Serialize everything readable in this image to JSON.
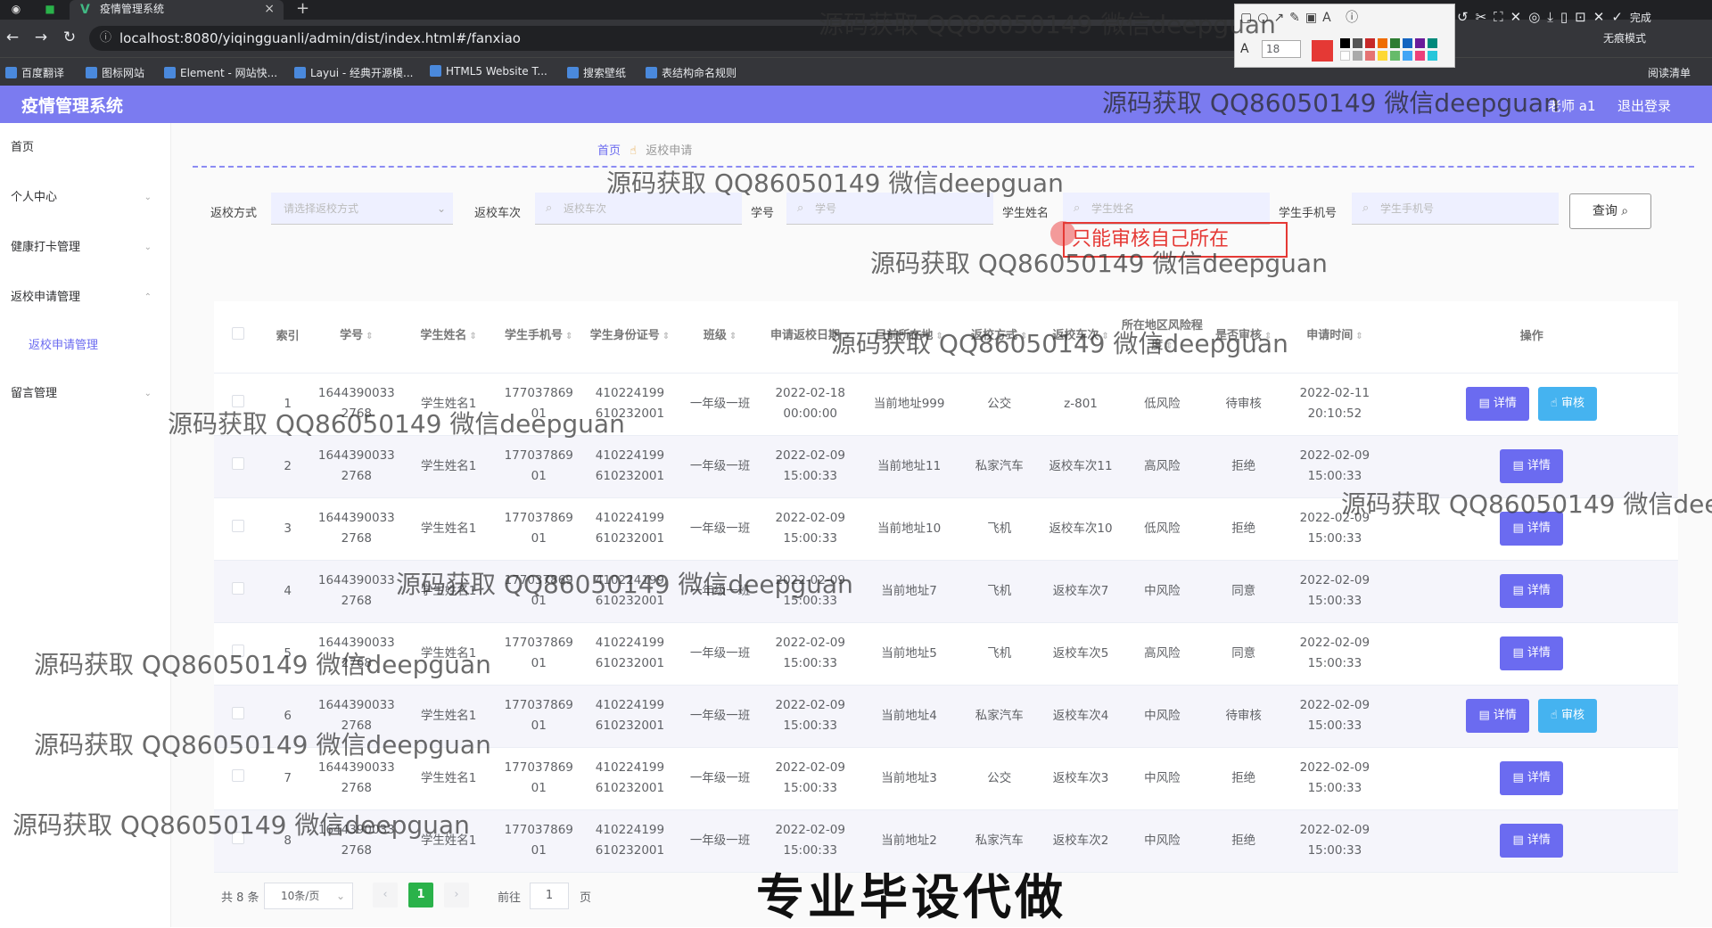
{
  "browser": {
    "tab_title": "疫情管理系统",
    "url": "localhost:8080/yiqingguanli/admin/dist/index.html#/fanxiao",
    "incognito": "无痕模式",
    "reading_list": "阅读清单",
    "bookmarks": [
      {
        "label": "百度翻译"
      },
      {
        "label": "图标网站"
      },
      {
        "label": "Element - 网站快..."
      },
      {
        "label": "Layui - 经典开源模..."
      },
      {
        "label": "HTML5 Website T..."
      },
      {
        "label": "搜索壁纸"
      },
      {
        "label": "表结构命名规则"
      }
    ]
  },
  "annotation_toolbar": {
    "font_size": "18",
    "done_label": "完成"
  },
  "app": {
    "title": "疫情管理系统",
    "user": "老师 a1",
    "logout": "退出登录"
  },
  "sidebar": {
    "items": [
      {
        "label": "首页"
      },
      {
        "label": "个人中心"
      },
      {
        "label": "健康打卡管理"
      },
      {
        "label": "返校申请管理"
      },
      {
        "label": "返校申请管理"
      },
      {
        "label": "留言管理"
      }
    ]
  },
  "breadcrumb": {
    "home": "首页",
    "current": "返校申请"
  },
  "filters": {
    "return_method": {
      "label": "返校方式",
      "placeholder": "请选择返校方式"
    },
    "train": {
      "label": "返校车次",
      "placeholder": "返校车次"
    },
    "student_no": {
      "label": "学号",
      "placeholder": "学号"
    },
    "student_name": {
      "label": "学生姓名",
      "placeholder": "学生姓名"
    },
    "student_phone": {
      "label": "学生手机号",
      "placeholder": "学生手机号"
    },
    "query_button": "查询"
  },
  "hint": "只能审核自己所在",
  "table": {
    "headers": [
      "索引",
      "学号",
      "学生姓名",
      "学生手机号",
      "学生身份证号",
      "班级",
      "申请返校日期",
      "目前所在地",
      "返校方式",
      "返校车次",
      "所在地区风险程度",
      "是否审核",
      "申请时间",
      "操作"
    ],
    "rows": [
      {
        "idx": "1",
        "no_a": "1644390033",
        "no_b": "2768",
        "name": "学生姓名1",
        "ph_a": "177037869",
        "ph_b": "01",
        "id_a": "410224199",
        "id_b": "610232001",
        "cls": "一年级一班",
        "dt_a": "2022-02-18",
        "dt_b": "00:00:00",
        "loc": "当前地址999",
        "method": "公交",
        "train": "z-801",
        "risk": "低风险",
        "status": "待审核",
        "at_a": "2022-02-11",
        "at_b": "20:10:52",
        "audit": true
      },
      {
        "idx": "2",
        "no_a": "1644390033",
        "no_b": "2768",
        "name": "学生姓名1",
        "ph_a": "177037869",
        "ph_b": "01",
        "id_a": "410224199",
        "id_b": "610232001",
        "cls": "一年级一班",
        "dt_a": "2022-02-09",
        "dt_b": "15:00:33",
        "loc": "当前地址11",
        "method": "私家汽车",
        "train": "返校车次11",
        "risk": "高风险",
        "status": "拒绝",
        "at_a": "2022-02-09",
        "at_b": "15:00:33",
        "audit": false
      },
      {
        "idx": "3",
        "no_a": "1644390033",
        "no_b": "2768",
        "name": "学生姓名1",
        "ph_a": "177037869",
        "ph_b": "01",
        "id_a": "410224199",
        "id_b": "610232001",
        "cls": "一年级一班",
        "dt_a": "2022-02-09",
        "dt_b": "15:00:33",
        "loc": "当前地址10",
        "method": "飞机",
        "train": "返校车次10",
        "risk": "低风险",
        "status": "拒绝",
        "at_a": "2022-02-09",
        "at_b": "15:00:33",
        "audit": false
      },
      {
        "idx": "4",
        "no_a": "1644390033",
        "no_b": "2768",
        "name": "学生姓名1",
        "ph_a": "177037869",
        "ph_b": "01",
        "id_a": "410224199",
        "id_b": "610232001",
        "cls": "一年级一班",
        "dt_a": "2022-02-09",
        "dt_b": "15:00:33",
        "loc": "当前地址7",
        "method": "飞机",
        "train": "返校车次7",
        "risk": "中风险",
        "status": "同意",
        "at_a": "2022-02-09",
        "at_b": "15:00:33",
        "audit": false
      },
      {
        "idx": "5",
        "no_a": "1644390033",
        "no_b": "2768",
        "name": "学生姓名1",
        "ph_a": "177037869",
        "ph_b": "01",
        "id_a": "410224199",
        "id_b": "610232001",
        "cls": "一年级一班",
        "dt_a": "2022-02-09",
        "dt_b": "15:00:33",
        "loc": "当前地址5",
        "method": "飞机",
        "train": "返校车次5",
        "risk": "高风险",
        "status": "同意",
        "at_a": "2022-02-09",
        "at_b": "15:00:33",
        "audit": false
      },
      {
        "idx": "6",
        "no_a": "1644390033",
        "no_b": "2768",
        "name": "学生姓名1",
        "ph_a": "177037869",
        "ph_b": "01",
        "id_a": "410224199",
        "id_b": "610232001",
        "cls": "一年级一班",
        "dt_a": "2022-02-09",
        "dt_b": "15:00:33",
        "loc": "当前地址4",
        "method": "私家汽车",
        "train": "返校车次4",
        "risk": "中风险",
        "status": "待审核",
        "at_a": "2022-02-09",
        "at_b": "15:00:33",
        "audit": true
      },
      {
        "idx": "7",
        "no_a": "1644390033",
        "no_b": "2768",
        "name": "学生姓名1",
        "ph_a": "177037869",
        "ph_b": "01",
        "id_a": "410224199",
        "id_b": "610232001",
        "cls": "一年级一班",
        "dt_a": "2022-02-09",
        "dt_b": "15:00:33",
        "loc": "当前地址3",
        "method": "公交",
        "train": "返校车次3",
        "risk": "中风险",
        "status": "拒绝",
        "at_a": "2022-02-09",
        "at_b": "15:00:33",
        "audit": false
      },
      {
        "idx": "8",
        "no_a": "1644390033",
        "no_b": "2768",
        "name": "学生姓名1",
        "ph_a": "177037869",
        "ph_b": "01",
        "id_a": "410224199",
        "id_b": "610232001",
        "cls": "一年级一班",
        "dt_a": "2022-02-09",
        "dt_b": "15:00:33",
        "loc": "当前地址2",
        "method": "私家汽车",
        "train": "返校车次2",
        "risk": "中风险",
        "status": "拒绝",
        "at_a": "2022-02-09",
        "at_b": "15:00:33",
        "audit": false
      }
    ],
    "detail_label": "详情",
    "audit_label": "审核"
  },
  "pagination": {
    "total": "共 8 条",
    "page_size": "10条/页",
    "current": "1",
    "goto_prefix": "前往",
    "goto_value": "1",
    "goto_suffix": "页"
  },
  "watermark": "源码获取 QQ86050149 微信deepguan",
  "banner": "专业毕设代做",
  "colors": {
    "primary": "#7b7bf0",
    "detail_button": "#6b6bf0",
    "audit_button": "#45b3f0",
    "page_active": "#2ab24a"
  }
}
